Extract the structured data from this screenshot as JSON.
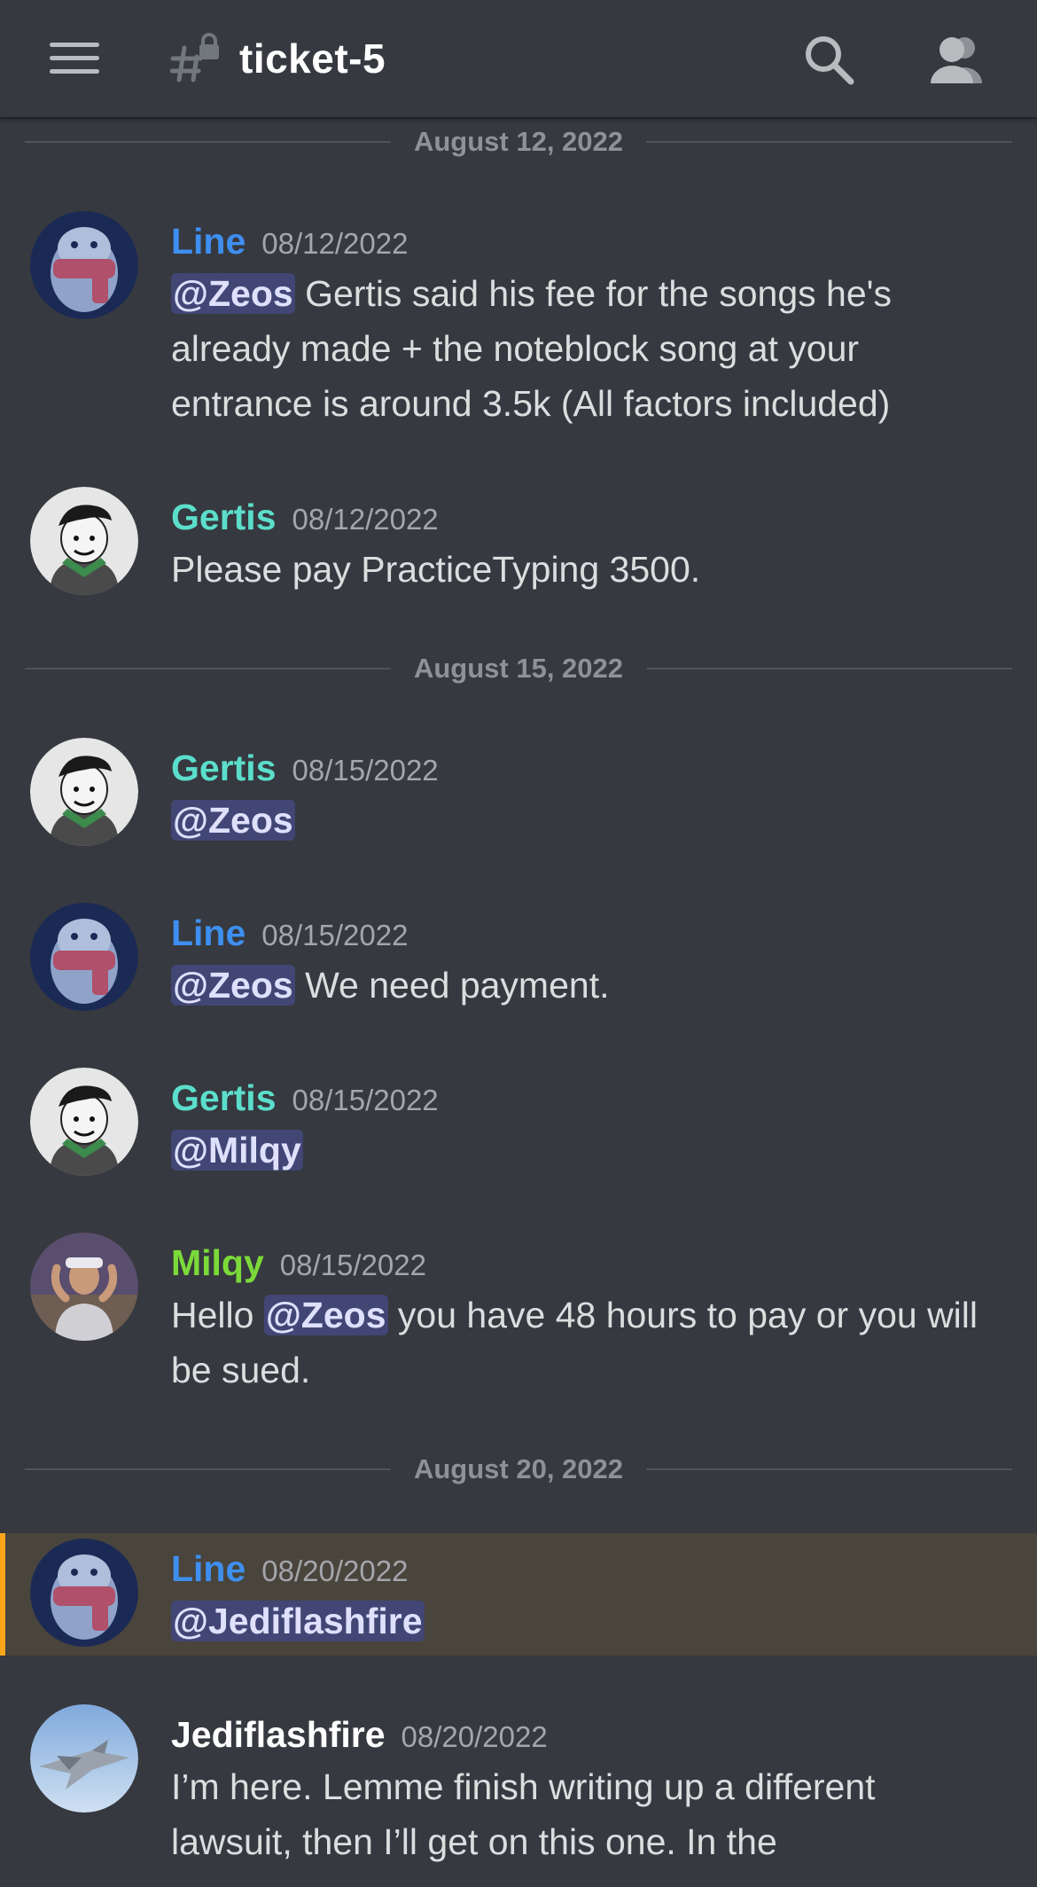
{
  "header": {
    "channel_name": "ticket-5",
    "menu_icon": "hamburger-icon",
    "channel_icon": "locked-hashtag-icon",
    "search_icon": "search-icon",
    "members_icon": "members-icon"
  },
  "colors": {
    "background": "#36393f",
    "mention_bg": "#414675",
    "highlight_bg": "#49443c",
    "highlight_bar": "#faa61a",
    "line": "#3e8ff0",
    "gertis": "#5bdecb",
    "milqy": "#7bda3a",
    "jediflashfire": "#ffffff"
  },
  "dividers": [
    "August 12, 2022",
    "August 15, 2022",
    "August 20, 2022"
  ],
  "messages": [
    {
      "author": "Line",
      "time": "08/12/2022",
      "mention": "@Zeos",
      "text_a": " Gertis said his fee for the songs he's already made + the noteblock song at your entrance is around 3.5k (All factors included)"
    },
    {
      "author": "Gertis",
      "time": "08/12/2022",
      "text_a": "Please pay PracticeTyping 3500."
    },
    {
      "author": "Gertis",
      "time": "08/15/2022",
      "mention": "@Zeos"
    },
    {
      "author": "Line",
      "time": "08/15/2022",
      "mention": "@Zeos",
      "text_a": " We need payment."
    },
    {
      "author": "Gertis",
      "time": "08/15/2022",
      "mention": "@Milqy"
    },
    {
      "author": "Milqy",
      "time": "08/15/2022",
      "text_a": "Hello ",
      "mention": "@Zeos",
      "text_b": " you have 48 hours to pay or you will be sued."
    },
    {
      "author": "Line",
      "time": "08/20/2022",
      "mention": "@Jediflashfire",
      "highlighted": true
    },
    {
      "author": "Jediflashfire",
      "time": "08/20/2022",
      "text_a": "I’m here. Lemme finish writing up a different lawsuit, then I’ll get on this one. In the"
    }
  ]
}
